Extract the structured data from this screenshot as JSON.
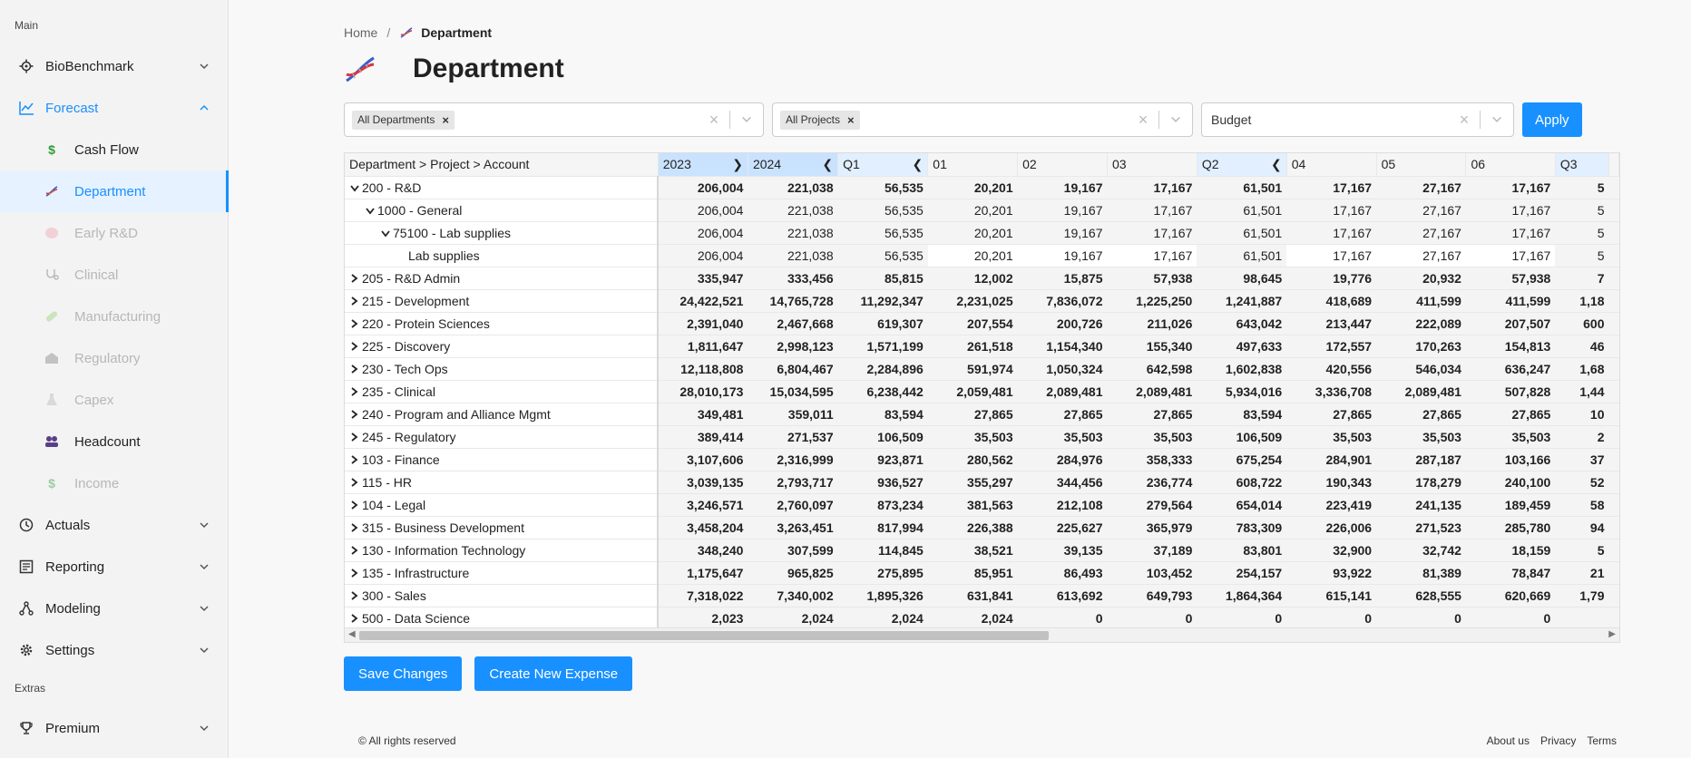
{
  "sidebar": {
    "section_main": "Main",
    "section_extras": "Extras",
    "items": [
      {
        "label": "BioBenchmark",
        "icon": "target-icon"
      },
      {
        "label": "Forecast",
        "icon": "chart-line-icon"
      },
      {
        "label": "Actuals",
        "icon": "clock-icon"
      },
      {
        "label": "Reporting",
        "icon": "report-icon"
      },
      {
        "label": "Modeling",
        "icon": "network-icon"
      },
      {
        "label": "Settings",
        "icon": "gear-icon"
      },
      {
        "label": "Premium",
        "icon": "trophy-icon"
      }
    ],
    "forecast_sub": [
      {
        "label": "Cash Flow",
        "icon": "dollar-icon"
      },
      {
        "label": "Department",
        "icon": "dna-icon"
      },
      {
        "label": "Early R&D",
        "icon": "brain-icon"
      },
      {
        "label": "Clinical",
        "icon": "stethoscope-icon"
      },
      {
        "label": "Manufacturing",
        "icon": "pill-icon"
      },
      {
        "label": "Regulatory",
        "icon": "building-icon"
      },
      {
        "label": "Capex",
        "icon": "flask-icon"
      },
      {
        "label": "Headcount",
        "icon": "people-icon"
      },
      {
        "label": "Income",
        "icon": "dollar-icon"
      }
    ]
  },
  "breadcrumb": {
    "home": "Home",
    "separator": "/",
    "current": "Department"
  },
  "page": {
    "title": "Department"
  },
  "filters": {
    "department_chip": "All Departments",
    "project_chip": "All Projects",
    "scenario_value": "Budget",
    "apply_label": "Apply"
  },
  "grid": {
    "header_label": "Department > Project > Account",
    "columns": [
      "2023",
      "2024",
      "Q1",
      "01",
      "02",
      "03",
      "Q2",
      "04",
      "05",
      "06",
      "Q3"
    ],
    "rows": [
      {
        "label": "200 - R&D",
        "values": [
          "206,004",
          "221,038",
          "56,535",
          "20,201",
          "19,167",
          "17,167",
          "61,501",
          "17,167",
          "27,167",
          "17,167",
          "5"
        ]
      },
      {
        "label": "1000 - General",
        "values": [
          "206,004",
          "221,038",
          "56,535",
          "20,201",
          "19,167",
          "17,167",
          "61,501",
          "17,167",
          "27,167",
          "17,167",
          "5"
        ]
      },
      {
        "label": "75100 - Lab supplies",
        "values": [
          "206,004",
          "221,038",
          "56,535",
          "20,201",
          "19,167",
          "17,167",
          "61,501",
          "17,167",
          "27,167",
          "17,167",
          "5"
        ]
      },
      {
        "label": "Lab supplies",
        "values": [
          "206,004",
          "221,038",
          "56,535",
          "20,201",
          "19,167",
          "17,167",
          "61,501",
          "17,167",
          "27,167",
          "17,167",
          "5"
        ]
      },
      {
        "label": "205 - R&D Admin",
        "values": [
          "335,947",
          "333,456",
          "85,815",
          "12,002",
          "15,875",
          "57,938",
          "98,645",
          "19,776",
          "20,932",
          "57,938",
          "7"
        ]
      },
      {
        "label": "215 - Development",
        "values": [
          "24,422,521",
          "14,765,728",
          "11,292,347",
          "2,231,025",
          "7,836,072",
          "1,225,250",
          "1,241,887",
          "418,689",
          "411,599",
          "411,599",
          "1,18"
        ]
      },
      {
        "label": "220 - Protein Sciences",
        "values": [
          "2,391,040",
          "2,467,668",
          "619,307",
          "207,554",
          "200,726",
          "211,026",
          "643,042",
          "213,447",
          "222,089",
          "207,507",
          "600"
        ]
      },
      {
        "label": "225 - Discovery",
        "values": [
          "1,811,647",
          "2,998,123",
          "1,571,199",
          "261,518",
          "1,154,340",
          "155,340",
          "497,633",
          "172,557",
          "170,263",
          "154,813",
          "46"
        ]
      },
      {
        "label": "230 - Tech Ops",
        "values": [
          "12,118,808",
          "6,804,467",
          "2,284,896",
          "591,974",
          "1,050,324",
          "642,598",
          "1,602,838",
          "420,556",
          "546,034",
          "636,247",
          "1,68"
        ]
      },
      {
        "label": "235 - Clinical",
        "values": [
          "28,010,173",
          "15,034,595",
          "6,238,442",
          "2,059,481",
          "2,089,481",
          "2,089,481",
          "5,934,016",
          "3,336,708",
          "2,089,481",
          "507,828",
          "1,44"
        ]
      },
      {
        "label": "240 - Program and Alliance Mgmt",
        "values": [
          "349,481",
          "359,011",
          "83,594",
          "27,865",
          "27,865",
          "27,865",
          "83,594",
          "27,865",
          "27,865",
          "27,865",
          "10"
        ]
      },
      {
        "label": "245 - Regulatory",
        "values": [
          "389,414",
          "271,537",
          "106,509",
          "35,503",
          "35,503",
          "35,503",
          "106,509",
          "35,503",
          "35,503",
          "35,503",
          "2"
        ]
      },
      {
        "label": "103 - Finance",
        "values": [
          "3,107,606",
          "2,316,999",
          "923,871",
          "280,562",
          "284,976",
          "358,333",
          "675,254",
          "284,901",
          "287,187",
          "103,166",
          "37"
        ]
      },
      {
        "label": "115 - HR",
        "values": [
          "3,039,135",
          "2,793,717",
          "936,527",
          "355,297",
          "344,456",
          "236,774",
          "608,722",
          "190,343",
          "178,279",
          "240,100",
          "52"
        ]
      },
      {
        "label": "104 - Legal",
        "values": [
          "3,246,571",
          "2,760,097",
          "873,234",
          "381,563",
          "212,108",
          "279,564",
          "654,014",
          "223,419",
          "241,135",
          "189,459",
          "58"
        ]
      },
      {
        "label": "315 - Business Development",
        "values": [
          "3,458,204",
          "3,263,451",
          "817,994",
          "226,388",
          "225,627",
          "365,979",
          "783,309",
          "226,006",
          "271,523",
          "285,780",
          "94"
        ]
      },
      {
        "label": "130 - Information Technology",
        "values": [
          "348,240",
          "307,599",
          "114,845",
          "38,521",
          "39,135",
          "37,189",
          "83,801",
          "32,900",
          "32,742",
          "18,159",
          "5"
        ]
      },
      {
        "label": "135 - Infrastructure",
        "values": [
          "1,175,647",
          "965,825",
          "275,895",
          "85,951",
          "86,493",
          "103,452",
          "254,157",
          "93,922",
          "81,389",
          "78,847",
          "21"
        ]
      },
      {
        "label": "300 - Sales",
        "values": [
          "7,318,022",
          "7,340,002",
          "1,895,326",
          "631,841",
          "613,692",
          "649,793",
          "1,864,364",
          "615,141",
          "628,555",
          "620,669",
          "1,79"
        ]
      },
      {
        "label": "500 - Data Science",
        "values": [
          "2,023",
          "2,024",
          "2,024",
          "2,024",
          "0",
          "0",
          "0",
          "0",
          "0",
          "0",
          ""
        ]
      }
    ]
  },
  "actions": {
    "save": "Save Changes",
    "create": "Create New Expense"
  },
  "footer": {
    "copyright": "© All rights reserved",
    "links": [
      "About us",
      "Privacy",
      "Terms"
    ]
  },
  "colors": {
    "accent": "#1890ff"
  }
}
